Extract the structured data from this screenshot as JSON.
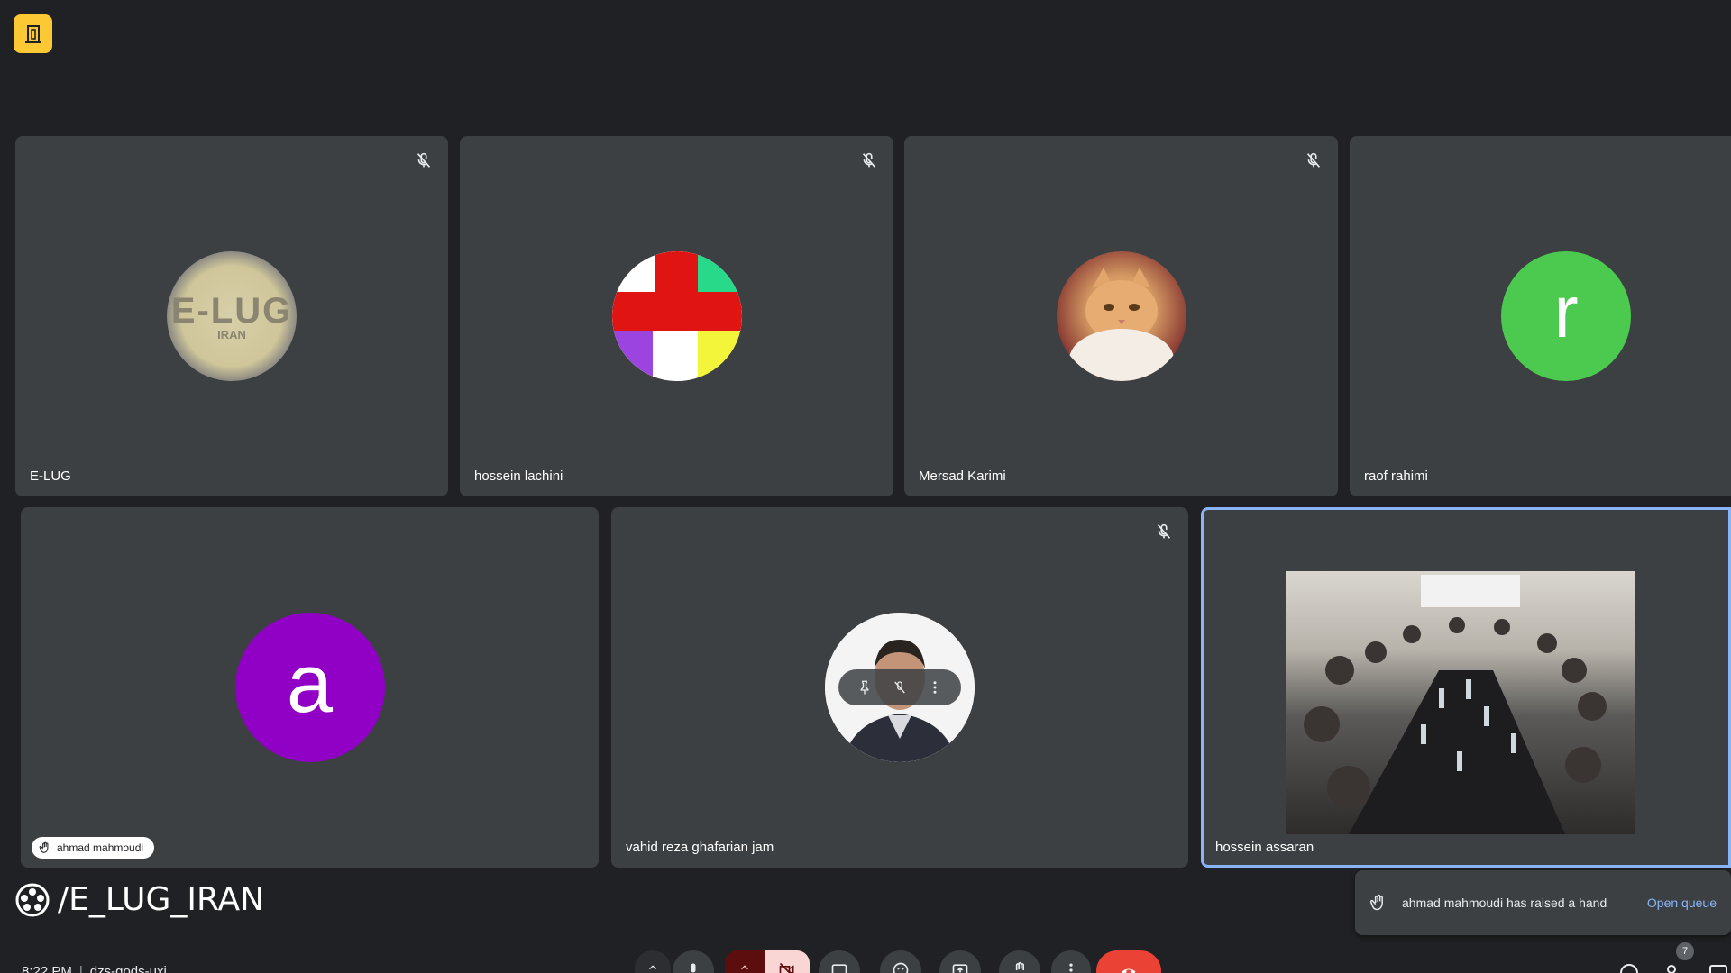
{
  "participants_row1": [
    {
      "name": "E-LUG",
      "muted": true,
      "avatar": "elug-logo"
    },
    {
      "name": "hossein lachini",
      "muted": true,
      "avatar": "color-blocks"
    },
    {
      "name": "Mersad Karimi",
      "muted": true,
      "avatar": "cat-photo"
    },
    {
      "name": "raof rahimi",
      "muted": false,
      "avatar_letter": "r",
      "avatar_color": "#4cca4f"
    }
  ],
  "participants_row2": [
    {
      "name": "ahmad mahmoudi",
      "hand_raised": true,
      "avatar_letter": "a",
      "avatar_color": "#9000c5"
    },
    {
      "name": "vahid reza ghafarian jam",
      "muted": true,
      "avatar": "portrait"
    },
    {
      "name": "hossein assaran",
      "active_speaker": true,
      "video": "room-camera"
    }
  ],
  "elug_logo_text": "E-LUG",
  "elug_logo_subtext": "IRAN",
  "overlay_handle": "/E_LUG_IRAN",
  "toast": {
    "message": "ahmad mahmoudi has raised a hand",
    "action": "Open queue"
  },
  "meeting": {
    "time": "8:22 PM",
    "code": "dzs-gods-uxi"
  },
  "people_count": "7",
  "colors": {
    "background": "#202124",
    "tile": "#3c4043",
    "accent": "#8ab4f8",
    "hangup": "#ea4335",
    "badge": "#fcc934"
  }
}
